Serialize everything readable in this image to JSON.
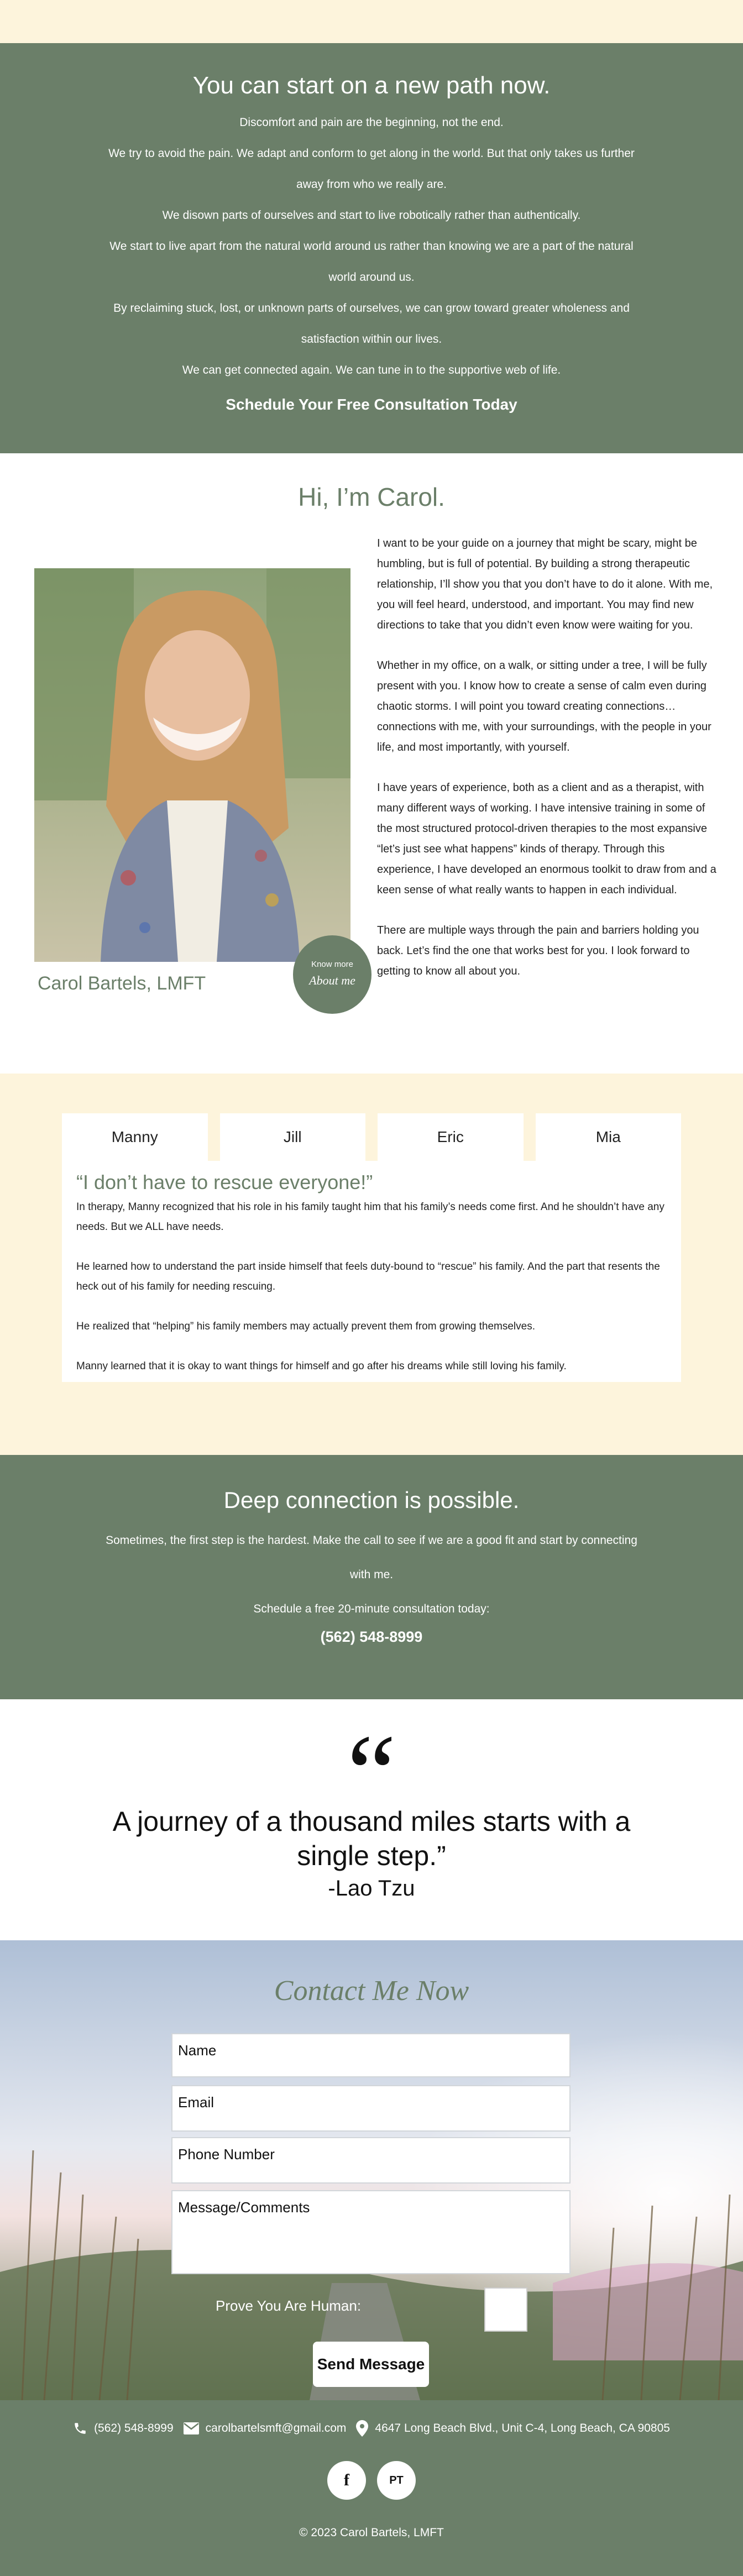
{
  "path": {
    "title": "You can start on a new path now.",
    "lines": [
      "Discomfort and pain are the beginning, not the end.",
      "We try to avoid the pain. We adapt and conform to get along in the world. But that only takes us further away from who we really are.",
      "We disown parts of ourselves and start to live robotically rather than authentically.",
      "We start to live apart from the natural world around us rather than knowing we are a part of the natural world around us.",
      "By reclaiming stuck, lost, or unknown parts of ourselves, we can grow toward greater wholeness and satisfaction within our lives.",
      "We can get connected again. We can tune in to the supportive web of life."
    ],
    "cta": "Schedule Your Free Consultation Today"
  },
  "about": {
    "title": "Hi, I’m Carol.",
    "caption": "Carol Bartels, LMFT",
    "badge_small": "Know more",
    "badge_big": "About me",
    "paragraphs": [
      "I want to be your guide on a journey that might be scary, might be humbling, but is full of potential. By building a strong therapeutic relationship, I’ll show you that you don’t have to do it alone. With me, you will feel heard, understood, and important. You may find new directions to take that you didn’t even know were waiting for you.",
      "Whether in my office, on a walk, or sitting under a tree, I will be fully present with you. I know how to create a sense of calm even during chaotic storms. I will point you toward creating connections… connections with me, with your surroundings, with the people in your life, and most importantly, with yourself.",
      "I have years of experience, both as a client and as a therapist, with many different ways of working. I have intensive training in some of the most structured protocol-driven therapies to the most expansive “let’s just see what happens” kinds of therapy. Through this experience, I have developed an enormous toolkit to draw from and a keen sense of what really wants to happen in each individual.",
      "There are multiple ways through the pain and barriers holding you back. Let’s find the one that works best for you. I look forward to getting to know all about you."
    ]
  },
  "tabs": {
    "labels": [
      "Manny",
      "Jill",
      "Eric",
      "Mia"
    ],
    "active": {
      "heading": "“I don’t have to rescue everyone!”",
      "paragraphs": [
        "In therapy, Manny recognized that his role in his family taught him that his family’s needs come first. And he shouldn’t have any needs. But we ALL have needs.",
        "He learned how to understand the part inside himself that feels duty-bound to “rescue” his family. And the part that resents the heck out of his family for needing rescuing.",
        "He realized that “helping” his family members may actually prevent them from growing themselves.",
        "Manny learned that it is okay to want things for himself and go after his dreams while still loving his family."
      ]
    }
  },
  "deep": {
    "title": "Deep connection is possible.",
    "line1": "Sometimes, the first step is the hardest. Make the call to see if we are a good fit and start by connecting with me.",
    "line2": "Schedule a free 20-minute consultation today:",
    "phone": "(562) 548-8999"
  },
  "quote": {
    "mark": "“",
    "text": "A journey of a thousand miles starts with a single step.”",
    "author": "-Lao Tzu"
  },
  "contact": {
    "title": "Contact Me Now",
    "name_placeholder": "Name",
    "email_placeholder": "Email",
    "phone_placeholder": "Phone Number",
    "message_placeholder": "Message/Comments",
    "human_label": "Prove You Are Human:",
    "human_eq": "",
    "send_label": "Send Message"
  },
  "footer": {
    "phone": "(562) 548-8999",
    "email": "carolbartelsmft@gmail.com",
    "address": "4647 Long Beach Blvd., Unit C-4, Long Beach, CA 90805",
    "social": [
      "f",
      "PT"
    ],
    "copyright": "© 2023 Carol Bartels, LMFT"
  },
  "colors": {
    "sage": "#6b7f69",
    "cream": "#fdf4dc"
  }
}
